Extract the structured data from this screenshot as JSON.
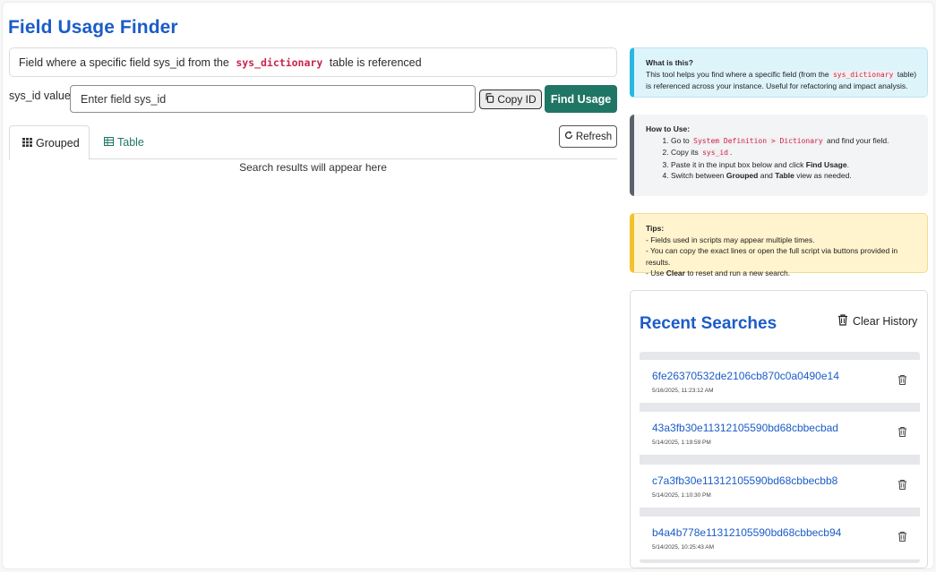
{
  "app": {
    "title": "Field Usage Finder"
  },
  "description": {
    "prefix": "Field where a specific field sys_id from the",
    "code": "sys_dictionary",
    "suffix": "table is referenced"
  },
  "search": {
    "label": "sys_id value",
    "placeholder": "Enter field sys_id",
    "value": "",
    "copy_label": "Copy ID",
    "find_label": "Find Usage"
  },
  "tabs": [
    {
      "label": "Grouped",
      "icon": "grid-icon",
      "active": true
    },
    {
      "label": "Table",
      "icon": "table-icon",
      "active": false
    }
  ],
  "refresh_label": "Refresh",
  "results_placeholder": "Search results will appear here",
  "info_card": {
    "title": "What is this?",
    "text1": "This tool helps you find where a specific field (from the",
    "code": "sys_dictionary",
    "text2": "table) is referenced across your instance. Useful for refactoring and impact analysis."
  },
  "how_card": {
    "title": "How to Use:",
    "steps": [
      {
        "pre": "Go to",
        "code": "System Definition > Dictionary",
        "post": "and find your field."
      },
      {
        "pre": "Copy its",
        "code": "sys_id",
        "post": "."
      },
      {
        "pre": "Paste it in the input box below and click",
        "bold": "Find Usage",
        "post": "."
      },
      {
        "pre": "Switch between",
        "bold1": "Grouped",
        "mid": "and",
        "bold2": "Table",
        "post": "view as needed."
      }
    ]
  },
  "tips_card": {
    "title": "Tips:",
    "line1": "- Fields used in scripts may appear multiple times.",
    "line2": "- You can copy the exact lines or open the full script via buttons provided in results.",
    "line3_pre": "- Use",
    "line3_bold": "Clear",
    "line3_post": "to reset and run a new search."
  },
  "recent": {
    "title": "Recent Searches",
    "clear_label": "Clear History",
    "items": [
      {
        "id": "6fe26370532de2106cb870c0a0490e14",
        "time": "5/16/2025, 11:23:12 AM"
      },
      {
        "id": "43a3fb30e11312105590bd68cbbecbad",
        "time": "5/14/2025, 1:19:59 PM"
      },
      {
        "id": "c7a3fb30e11312105590bd68cbbecbb8",
        "time": "5/14/2025, 1:10:30 PM"
      },
      {
        "id": "b4a4b778e11312105590bd68cbbecb94",
        "time": "5/14/2025, 10:25:43 AM"
      }
    ]
  }
}
